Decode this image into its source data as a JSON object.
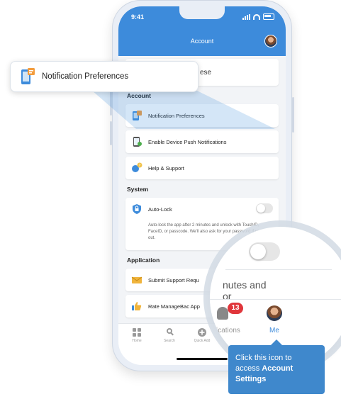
{
  "status_bar": {
    "time": "9:41"
  },
  "app_bar": {
    "title": "Account"
  },
  "top_card_fragment": "ese",
  "sections": {
    "account": {
      "title": "Account",
      "items": [
        {
          "label": "Notification Preferences",
          "icon": "notification-preferences-icon"
        },
        {
          "label": "Enable Device Push Notifications",
          "icon": "phone-push-icon"
        },
        {
          "label": "Help & Support",
          "icon": "help-support-icon"
        }
      ]
    },
    "system": {
      "title": "System",
      "auto_lock": {
        "label": "Auto-Lock",
        "enabled": false,
        "description": "Auto-lock the app after 2 minutes and unlock with TouchID, FaceID, or passcode. We'll also ask for your password if you log out."
      }
    },
    "application": {
      "title": "Application",
      "items": [
        {
          "label": "Submit Support Requ",
          "icon": "envelope-icon"
        },
        {
          "label": "Rate ManageBac App",
          "icon": "thumbs-up-icon"
        }
      ]
    }
  },
  "tab_bar": {
    "tabs": [
      {
        "label": "Home",
        "icon": "grid-icon"
      },
      {
        "label": "Search",
        "icon": "search-icon"
      },
      {
        "label": "Quick Add",
        "icon": "plus-icon"
      }
    ]
  },
  "callout": {
    "label": "Notification Preferences"
  },
  "magnifier": {
    "fragment_line1": "nutes and",
    "fragment_line2": "or",
    "badge_count": "13",
    "notifications_label": "ifications",
    "me_label": "Me"
  },
  "tooltip": {
    "text_line1": "Click this icon to",
    "text_prefix": "access ",
    "text_bold": "Account Settings"
  },
  "colors": {
    "accent": "#3d8bdb",
    "tooltip": "#3f88cc",
    "badge": "#e0363b"
  }
}
